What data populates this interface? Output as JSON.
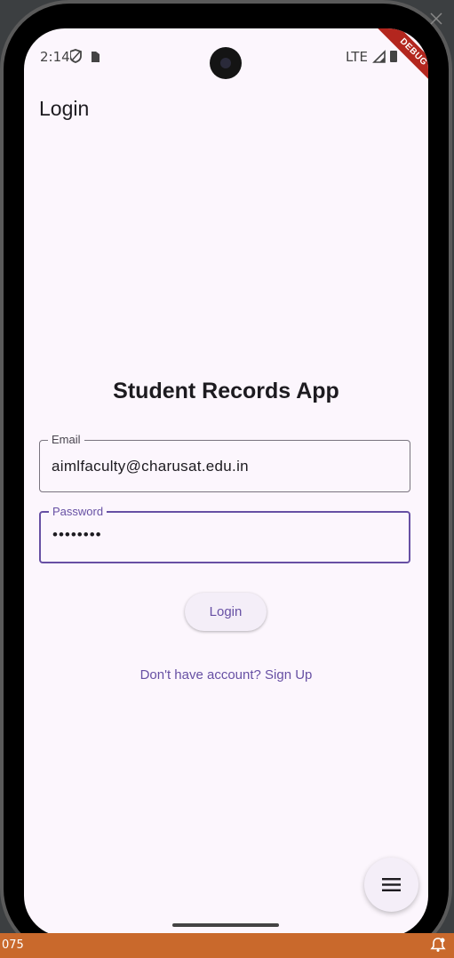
{
  "host": {
    "counter_text": "075"
  },
  "status_bar": {
    "time": "2:14",
    "network": "LTE",
    "left_icons": [
      "shield-icon",
      "sim-card-icon"
    ],
    "right_icons": [
      "signal-icon",
      "battery-icon"
    ]
  },
  "debug_banner": "DEBUG",
  "app_bar": {
    "title": "Login"
  },
  "main": {
    "heading": "Student Records App",
    "email": {
      "label": "Email",
      "value": "aimlfaculty@charusat.edu.in"
    },
    "password": {
      "label": "Password",
      "value": "••••••••"
    },
    "login_button": "Login",
    "signup_link": "Don't have account? Sign Up"
  },
  "fab": {
    "icon": "menu-icon"
  },
  "colors": {
    "primary": "#6750a4",
    "background": "#fcf6fd",
    "debug": "#b3261e"
  }
}
